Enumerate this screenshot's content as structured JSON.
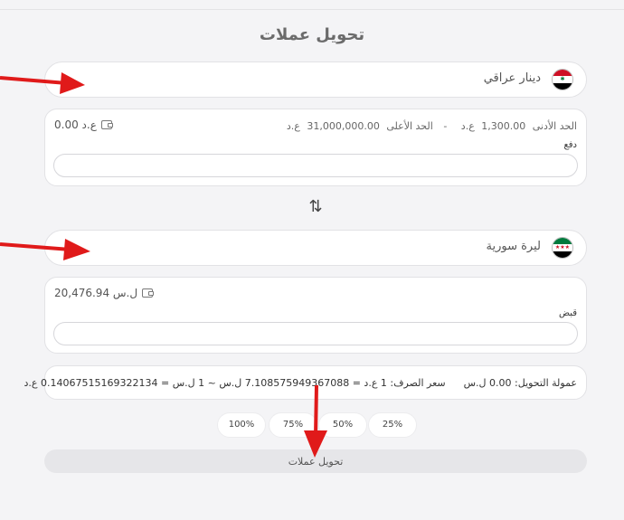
{
  "title": "تحويل عملات",
  "from": {
    "currency_name": "دينار عراقي",
    "flag_colors": [
      "#ce1126",
      "#ffffff",
      "#000000"
    ],
    "balance": "0.00 ع.د",
    "limit_min_label": "الحد الأدنى",
    "limit_min_value": "1,300.00",
    "limit_min_unit": "ع.د",
    "limit_sep": "-",
    "limit_max_label": "الحد الأعلى",
    "limit_max_value": "31,000,000.00",
    "limit_max_unit": "ع.د",
    "field_label": "دفع",
    "input_value": ""
  },
  "to": {
    "currency_name": "ليرة سورية",
    "flag_colors": [
      "#007a3d",
      "#ffffff",
      "#000000"
    ],
    "balance": "20,476.94 ل.س",
    "field_label": "قبض",
    "input_value": ""
  },
  "info": {
    "fee": "عمولة التحويل: 0.00 ل.س",
    "rate": "سعر الصرف: 1 ع.د = 7.108575949367088 ل.س ~ 1 ل.س = 0.14067515169322134 ع.د"
  },
  "percent_buttons": [
    "100%",
    "75%",
    "50%",
    "25%"
  ],
  "submit_label": "تحويل عملات",
  "accent": "#e01a1a"
}
